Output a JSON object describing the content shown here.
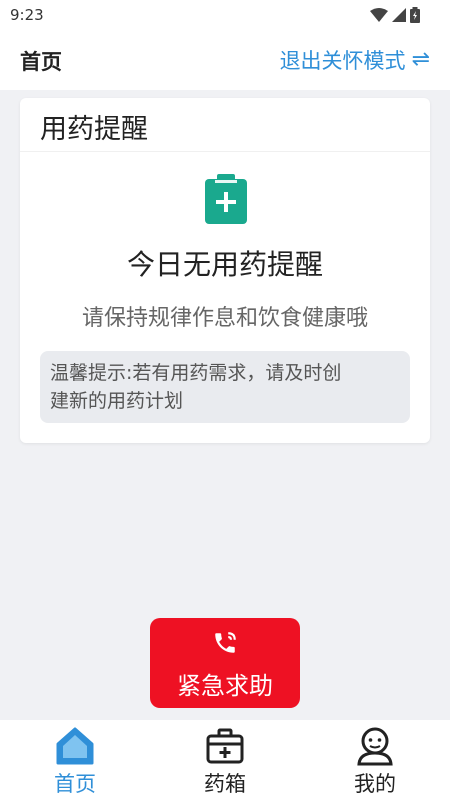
{
  "status_bar": {
    "time": "9:23"
  },
  "header": {
    "title": "首页",
    "care_mode_label": "退出关怀模式",
    "swap_symbol": "⇌"
  },
  "reminder_card": {
    "title": "用药提醒",
    "empty_title": "今日无用药提醒",
    "empty_subtitle": "请保持规律作息和饮食健康哦",
    "tip_line1": "温馨提示:若有用药需求，请及时创",
    "tip_line2": "建新的用药计划"
  },
  "sos": {
    "label": "紧急求助"
  },
  "bottom_nav": {
    "items": [
      {
        "label": "首页",
        "icon": "home-icon",
        "active": true
      },
      {
        "label": "药箱",
        "icon": "medicine-box-icon",
        "active": false
      },
      {
        "label": "我的",
        "icon": "profile-icon",
        "active": false
      }
    ]
  },
  "colors": {
    "accent": "#2f8fd8",
    "sos": "#ee1123",
    "clipboard": "#1aa98e",
    "background": "#f0f1f4"
  }
}
